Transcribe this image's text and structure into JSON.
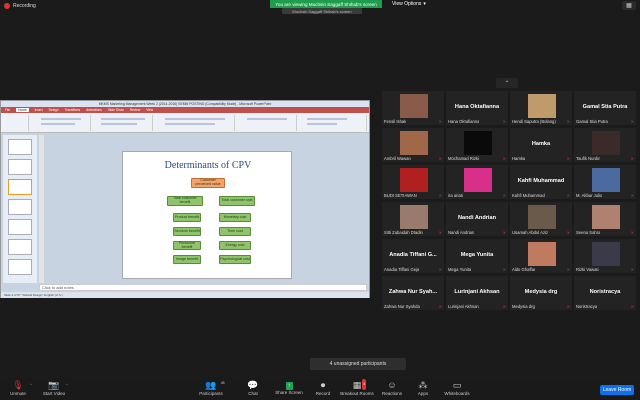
{
  "top": {
    "recording_label": "Recording",
    "viewing_banner": "You are viewing Muchsin Saggaff Shihab's screen",
    "view_options": "View Options",
    "speaker_name": "Muchsin Saggaff Shihab's screen"
  },
  "ppt": {
    "window_title": "MKMS Marketing Management Week 2 (2014-2015) SEMM POSTING [Compatibility Mode] - Microsoft PowerPoint",
    "tabs": [
      "File",
      "Home",
      "Insert",
      "Design",
      "Transitions",
      "Animations",
      "Slide Show",
      "Review",
      "View"
    ],
    "slide_title": "Determinants of CPV",
    "top_box": "Customer perceived value",
    "left_column": [
      "Total customer benefit",
      "Product benefit",
      "Services benefit",
      "Personnel benefit",
      "Image benefit"
    ],
    "right_column": [
      "Total customer cost",
      "Monetary cost",
      "Time cost",
      "Energy cost",
      "Psychological cost"
    ],
    "notes_placeholder": "Click to add notes",
    "status_text": "Slide 4 of 57   \"Default Design\"   English (U.S.)"
  },
  "gallery": {
    "tiles": [
      {
        "name": "Fensil Ishak",
        "center": "",
        "photo": "#8a5b4a",
        "muted": true
      },
      {
        "name": "Hana Oktafianna",
        "center": "Hana Oktafianna",
        "photo": "",
        "muted": true
      },
      {
        "name": "Hendi Saputra (Bolang)",
        "center": "",
        "photo": "#c09a6a",
        "muted": true
      },
      {
        "name": "Gamal Stia Putra",
        "center": "Gamal Stia Putra",
        "photo": "",
        "muted": true
      },
      {
        "name": "Ambril Wawan",
        "center": "",
        "photo": "#a06848",
        "muted": true
      },
      {
        "name": "Mochamad Rizki",
        "center": "",
        "photo": "#0a0a0a",
        "muted": true
      },
      {
        "name": "Hamka",
        "center": "Hamka",
        "photo": "",
        "muted": true
      },
      {
        "name": "Taufik Nurdin",
        "center": "",
        "photo": "#3a2a2a",
        "muted": true
      },
      {
        "name": "BUDI SETIAWAN",
        "center": "",
        "photo": "#b02020",
        "muted": true
      },
      {
        "name": "ira ariati",
        "center": "",
        "photo": "#d8308a",
        "muted": true
      },
      {
        "name": "Kahfi Muhammad",
        "center": "Kahfi Muhammad",
        "photo": "",
        "muted": true
      },
      {
        "name": "M. Akbar Julio",
        "center": "",
        "photo": "#4a6aa0",
        "muted": true
      },
      {
        "name": "Sitti Zubaidah Dtadin",
        "center": "",
        "photo": "#9a7a6a",
        "muted": true
      },
      {
        "name": "Nandi Andrian",
        "center": "Nandi Andrian",
        "photo": "",
        "muted": true
      },
      {
        "name": "Usamah Abdul Aziz",
        "center": "",
        "photo": "#6a5a4a",
        "muted": true
      },
      {
        "name": "Seena Sahra",
        "center": "",
        "photo": "#b08070",
        "muted": true
      },
      {
        "name": "Anadia Tiffani Geja",
        "center": "Anadia Tiffani G...",
        "photo": "",
        "muted": true
      },
      {
        "name": "Mega Yunita",
        "center": "Mega Yunita",
        "photo": "",
        "muted": true
      },
      {
        "name": "Aldo Ghaffar",
        "center": "",
        "photo": "#c07a60",
        "muted": true
      },
      {
        "name": "Rizki Vawati",
        "center": "",
        "photo": "#3a3a4a",
        "muted": true
      },
      {
        "name": "Zahwa Nur Syahda",
        "center": "Zahwa Nur Syah...",
        "photo": "",
        "muted": true
      },
      {
        "name": "Lurinjani Akhsan",
        "center": "Lurinjani Akhsan",
        "photo": "",
        "muted": true
      },
      {
        "name": "Medysia drg",
        "center": "Medysia drg",
        "photo": "",
        "muted": true
      },
      {
        "name": "Noristracya",
        "center": "Noristracya",
        "photo": "",
        "muted": true
      }
    ]
  },
  "unassigned_label": "4 unassigned participants",
  "toolbar": {
    "unmute": "Unmute",
    "start_video": "Start Video",
    "participants": "Participants",
    "participants_count": "45",
    "chat": "Chat",
    "share_screen": "Share Screen",
    "record": "Record",
    "breakout_rooms": "Breakout Rooms",
    "breakout_badge": "4",
    "reactions": "Reactions",
    "apps": "Apps",
    "whiteboards": "Whiteboards",
    "leave": "Leave Room"
  },
  "colors": {
    "banner_green": "#1f9d4d",
    "share_green": "#23a455",
    "leave_blue": "#0e71eb",
    "ppt_red": "#c0504d"
  }
}
